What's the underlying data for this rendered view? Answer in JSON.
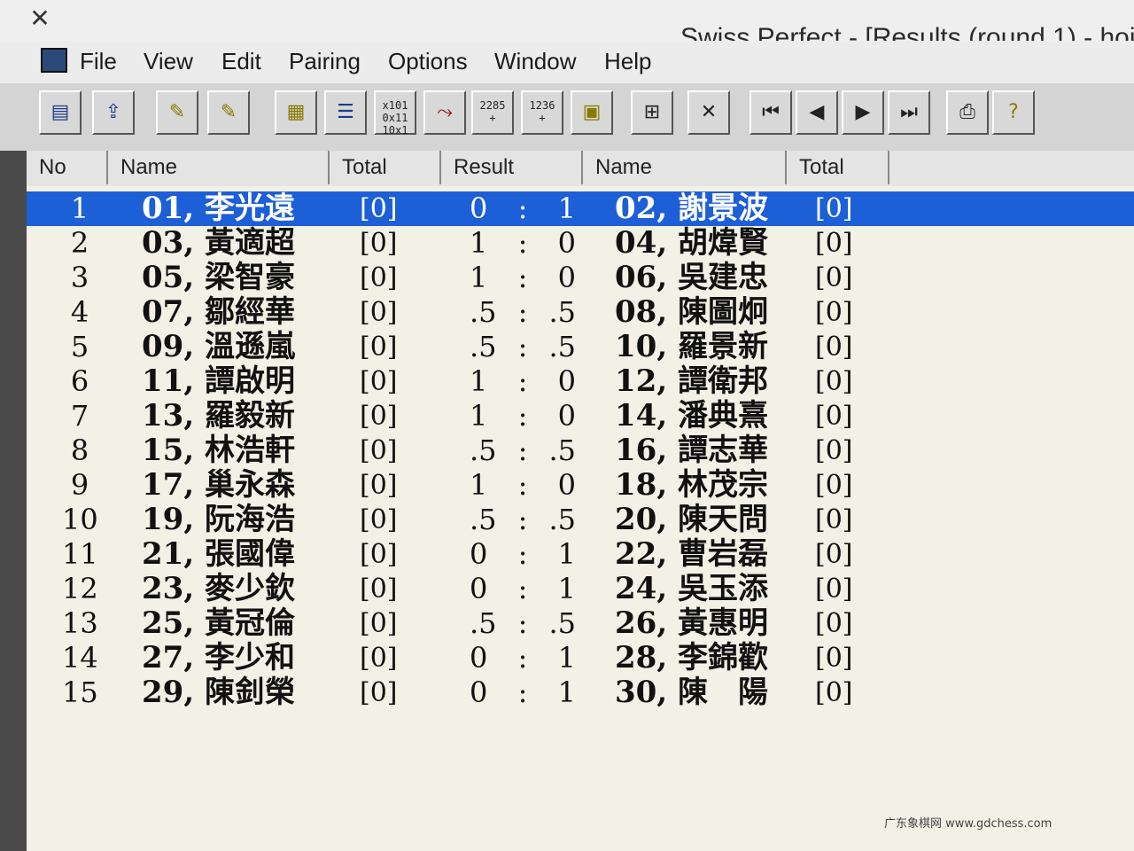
{
  "window": {
    "title": "Swiss Perfect - [Results  (round 1) - hoi",
    "app_icon": "crossed-pieces-icon"
  },
  "menu": [
    "File",
    "View",
    "Edit",
    "Pairing",
    "Options",
    "Window",
    "Help"
  ],
  "toolbar": {
    "icons": [
      "new-icon",
      "open-icon",
      "flashlight-icon",
      "flashlight-more-icon",
      "notes-icon",
      "list-icon",
      "binary-icon",
      "graph-icon",
      "add-2285-icon",
      "add-1236-icon",
      "image-icon",
      "table-icon",
      "cross-icon",
      "first-icon",
      "prev-icon",
      "next-icon",
      "last-icon",
      "print-icon",
      "help-icon"
    ],
    "label_2285": "2285",
    "label_1236": "1236"
  },
  "columns": {
    "no": "No",
    "name": "Name",
    "total": "Total",
    "result": "Result",
    "name2": "Name",
    "total2": "Total"
  },
  "rows": [
    {
      "no": "1",
      "name": "01, 李光遠",
      "total": "[0]",
      "r1": "0",
      "sep": ":",
      "r2": "1",
      "name2": "02, 謝景波",
      "total2": "[0]"
    },
    {
      "no": "2",
      "name": "03, 黃適超",
      "total": "[0]",
      "r1": "1",
      "sep": ":",
      "r2": "0",
      "name2": "04, 胡煒賢",
      "total2": "[0]"
    },
    {
      "no": "3",
      "name": "05, 梁智豪",
      "total": "[0]",
      "r1": "1",
      "sep": ":",
      "r2": "0",
      "name2": "06, 吳建忠",
      "total2": "[0]"
    },
    {
      "no": "4",
      "name": "07, 鄒經華",
      "total": "[0]",
      "r1": ".5",
      "sep": ":",
      "r2": ".5",
      "name2": "08, 陳圖炯",
      "total2": "[0]"
    },
    {
      "no": "5",
      "name": "09, 溫遜嵐",
      "total": "[0]",
      "r1": ".5",
      "sep": ":",
      "r2": ".5",
      "name2": "10, 羅景新",
      "total2": "[0]"
    },
    {
      "no": "6",
      "name": "11, 譚啟明",
      "total": "[0]",
      "r1": "1",
      "sep": ":",
      "r2": "0",
      "name2": "12, 譚衛邦",
      "total2": "[0]"
    },
    {
      "no": "7",
      "name": "13, 羅毅新",
      "total": "[0]",
      "r1": "1",
      "sep": ":",
      "r2": "0",
      "name2": "14, 潘典熹",
      "total2": "[0]"
    },
    {
      "no": "8",
      "name": "15, 林浩軒",
      "total": "[0]",
      "r1": ".5",
      "sep": ":",
      "r2": ".5",
      "name2": "16, 譚志華",
      "total2": "[0]"
    },
    {
      "no": "9",
      "name": "17, 巢永森",
      "total": "[0]",
      "r1": "1",
      "sep": ":",
      "r2": "0",
      "name2": "18, 林茂宗",
      "total2": "[0]"
    },
    {
      "no": "10",
      "name": "19, 阮海浩",
      "total": "[0]",
      "r1": ".5",
      "sep": ":",
      "r2": ".5",
      "name2": "20, 陳天問",
      "total2": "[0]"
    },
    {
      "no": "11",
      "name": "21, 張國偉",
      "total": "[0]",
      "r1": "0",
      "sep": ":",
      "r2": "1",
      "name2": "22, 曹岩磊",
      "total2": "[0]"
    },
    {
      "no": "12",
      "name": "23, 麥少欽",
      "total": "[0]",
      "r1": "0",
      "sep": ":",
      "r2": "1",
      "name2": "24, 吳玉添",
      "total2": "[0]"
    },
    {
      "no": "13",
      "name": "25, 黃冠倫",
      "total": "[0]",
      "r1": ".5",
      "sep": ":",
      "r2": ".5",
      "name2": "26, 黃惠明",
      "total2": "[0]"
    },
    {
      "no": "14",
      "name": "27, 李少和",
      "total": "[0]",
      "r1": "0",
      "sep": ":",
      "r2": "1",
      "name2": "28, 李錦歡",
      "total2": "[0]"
    },
    {
      "no": "15",
      "name": "29, 陳釗榮",
      "total": "[0]",
      "r1": "0",
      "sep": ":",
      "r2": "1",
      "name2": "30, 陳　陽",
      "total2": "[0]"
    }
  ],
  "selected_row": 1,
  "watermark": "广东象棋网 www.gdchess.com",
  "colors": {
    "selection": "#1d5fd6",
    "grid_bg": "#f3f0e6"
  }
}
